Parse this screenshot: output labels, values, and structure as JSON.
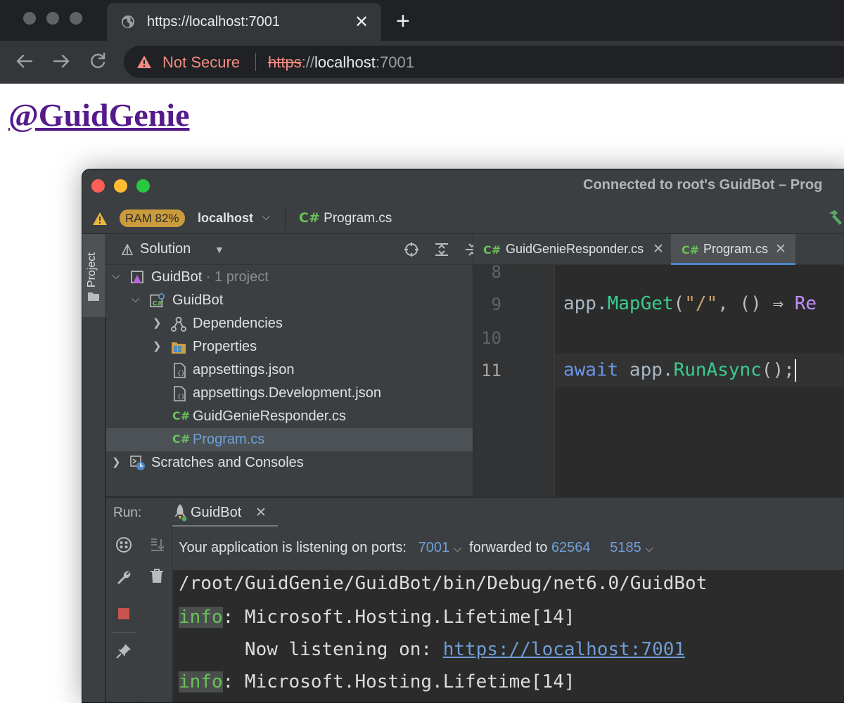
{
  "browser": {
    "tab_title": "https://localhost:7001",
    "close_glyph": "✕",
    "new_tab_glyph": "+",
    "security_label": "Not Secure",
    "url_scheme": "https",
    "url_sep": "://",
    "url_host": "localhost",
    "url_port": ":7001"
  },
  "page": {
    "link_text": "@GuidGenie"
  },
  "ide": {
    "title": "Connected to root's GuidBot – Prog",
    "toolbar": {
      "ram_badge": "RAM 82%",
      "host": "localhost",
      "file_icon": "C#",
      "file": "Program.cs"
    },
    "side_tab": "Project",
    "project": {
      "header": "Solution",
      "tree": [
        {
          "label": "GuidBot",
          "muted": " · 1 project"
        },
        {
          "label": "GuidBot"
        },
        {
          "label": "Dependencies"
        },
        {
          "label": "Properties"
        },
        {
          "label": "appsettings.json"
        },
        {
          "label": "appsettings.Development.json"
        },
        {
          "label": "GuidGenieResponder.cs",
          "icon": "C#"
        },
        {
          "label": "Program.cs",
          "icon": "C#"
        },
        {
          "label": "Scratches and Consoles"
        }
      ]
    },
    "editor": {
      "tabs": [
        {
          "icon": "C#",
          "label": "GuidGenieResponder.cs",
          "close": "✕"
        },
        {
          "icon": "C#",
          "label": "Program.cs",
          "close": "✕"
        }
      ],
      "line_numbers": [
        "8",
        "9",
        "10",
        "11"
      ],
      "line9": {
        "obj": "app.",
        "fn": "MapGet",
        "open": "(",
        "str": "\"/\"",
        "rest": ", () ⇒ ",
        "tail": "Re"
      },
      "line11": {
        "kw": "await",
        "obj": " app.",
        "fn": "RunAsync",
        "rest": "();"
      }
    },
    "run": {
      "label": "Run:",
      "tab": "GuidBot",
      "tab_close": "✕",
      "ports": {
        "prefix": "Your application is listening on ports:",
        "port1": "7001",
        "forwarded": "forwarded to",
        "forward_port": "62564",
        "port2": "5185"
      },
      "console": {
        "path": "/root/GuidGenie/GuidBot/bin/Debug/net6.0/GuidBot",
        "info": "info",
        "logger": ": Microsoft.Hosting.Lifetime[14]",
        "listening_prefix": "      Now listening on: ",
        "listening_url": "https://localhost:7001"
      }
    }
  },
  "colors": {
    "link_visited": "#551a8b",
    "not_secure": "#f28b82",
    "ram_badge": "#c99b3c",
    "csharp_green": "#6ac259",
    "accent_blue": "#4a88c7"
  }
}
